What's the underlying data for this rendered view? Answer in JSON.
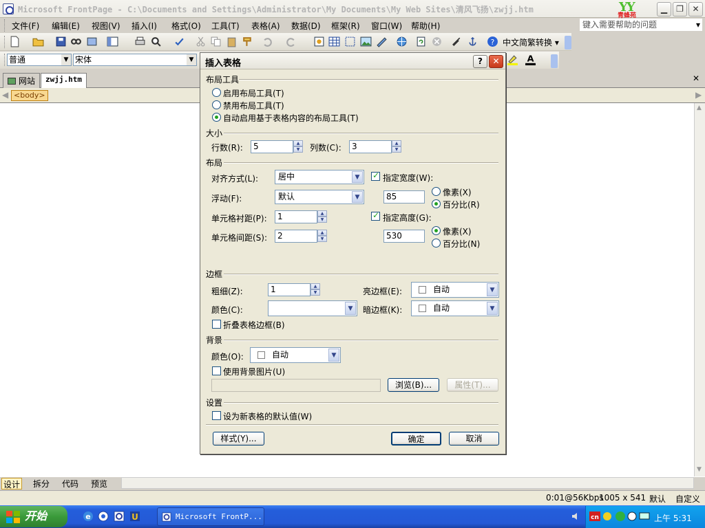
{
  "window": {
    "title": "Microsoft FrontPage - C:\\Documents and Settings\\Administrator\\My Documents\\My Web Sites\\清风飞扬\\zwjj.htm",
    "logo_text": "YY",
    "logo_sub": "青蜂苑"
  },
  "menubar": {
    "items": [
      "文件(F)",
      "编辑(E)",
      "视图(V)",
      "插入(I)",
      "格式(O)",
      "工具(T)",
      "表格(A)",
      "数据(D)",
      "框架(R)",
      "窗口(W)",
      "帮助(H)"
    ],
    "help_placeholder": "键入需要帮助的问题"
  },
  "toolbar": {
    "convert_label": "中文简繁转换 ▾"
  },
  "format_bar": {
    "style": "普通",
    "font": "宋体"
  },
  "tabs": {
    "site": "网站",
    "doc": "zwjj.htm"
  },
  "breadcrumb": {
    "tag": "<body>"
  },
  "view_tabs": [
    "设计",
    "拆分",
    "代码",
    "预览"
  ],
  "status": {
    "speed": "0:01@56Kbps",
    "size": "1005 x 541",
    "default": "默认",
    "custom": "自定义"
  },
  "taskbar": {
    "start": "开始",
    "task": "Microsoft FrontP...",
    "clock": "上午 5:31"
  },
  "dialog": {
    "title": "插入表格",
    "help": "?",
    "close": "✕",
    "layout_tools": {
      "heading": "布局工具",
      "options": [
        "启用布局工具(T)",
        "禁用布局工具(T)",
        "自动启用基于表格内容的布局工具(T)"
      ],
      "selected": 2
    },
    "size": {
      "heading": "大小",
      "rows_label": "行数(R):",
      "rows": "5",
      "cols_label": "列数(C):",
      "cols": "3"
    },
    "layout": {
      "heading": "布局",
      "align_label": "对齐方式(L):",
      "align": "居中",
      "float_label": "浮动(F):",
      "float": "默认",
      "padding_label": "单元格衬距(P):",
      "padding": "1",
      "spacing_label": "单元格间距(S):",
      "spacing": "2",
      "width_label": "指定宽度(W):",
      "width": "85",
      "width_checked": true,
      "height_label": "指定高度(G):",
      "height": "530",
      "height_checked": true,
      "unit_px": "像素(X)",
      "unit_pct": "百分比(R)",
      "unit_px2": "像素(X)",
      "unit_pct2": "百分比(N)",
      "width_unit": "percent",
      "height_unit": "pixels"
    },
    "border": {
      "heading": "边框",
      "size_label": "粗细(Z):",
      "size": "1",
      "light_label": "亮边框(E):",
      "light": "自动",
      "color_label": "颜色(C):",
      "color": "",
      "dark_label": "暗边框(K):",
      "dark": "自动",
      "collapse_label": "折叠表格边框(B)"
    },
    "background": {
      "heading": "背景",
      "color_label": "颜色(O):",
      "color": "自动",
      "use_image_label": "使用背景图片(U)",
      "browse": "浏览(B)...",
      "properties": "属性(T)..."
    },
    "settings": {
      "heading": "设置",
      "default_label": "设为新表格的默认值(W)"
    },
    "buttons": {
      "style": "样式(Y)...",
      "ok": "确定",
      "cancel": "取消"
    }
  }
}
